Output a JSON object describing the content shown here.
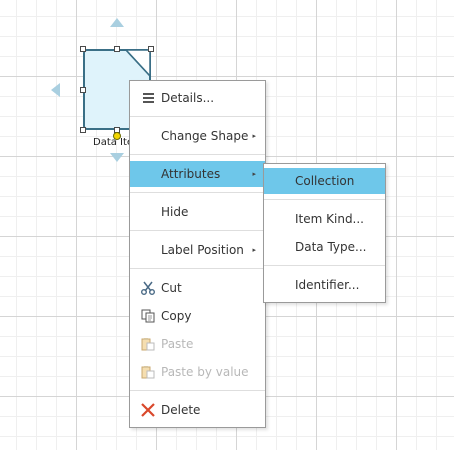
{
  "shape": {
    "label": "Data Ite"
  },
  "context_menu": {
    "items": [
      {
        "label": "Details...",
        "icon": "details-icon"
      },
      {
        "label": "Change Shape",
        "submenu": true
      },
      {
        "label": "Attributes",
        "submenu": true,
        "highlighted": true
      },
      {
        "label": "Hide"
      },
      {
        "label": "Label Position",
        "submenu": true
      },
      {
        "label": "Cut",
        "icon": "scissors-icon"
      },
      {
        "label": "Copy",
        "icon": "copy-icon"
      },
      {
        "label": "Paste",
        "icon": "paste-icon",
        "disabled": true
      },
      {
        "label": "Paste by value",
        "icon": "paste-value-icon",
        "disabled": true
      },
      {
        "label": "Delete",
        "icon": "delete-icon"
      }
    ],
    "submenu_arrow": "▸"
  },
  "attributes_submenu": {
    "items": [
      {
        "label": "Collection",
        "highlighted": true
      },
      {
        "label": "Item Kind..."
      },
      {
        "label": "Data Type..."
      },
      {
        "label": "Identifier..."
      }
    ]
  },
  "colors": {
    "highlight": "#6ec7ea",
    "shape_fill": "#dff3fb",
    "shape_border": "#3a6f86",
    "delete_icon": "#d9482b",
    "rotation_arrow": "#a9cfe0"
  }
}
